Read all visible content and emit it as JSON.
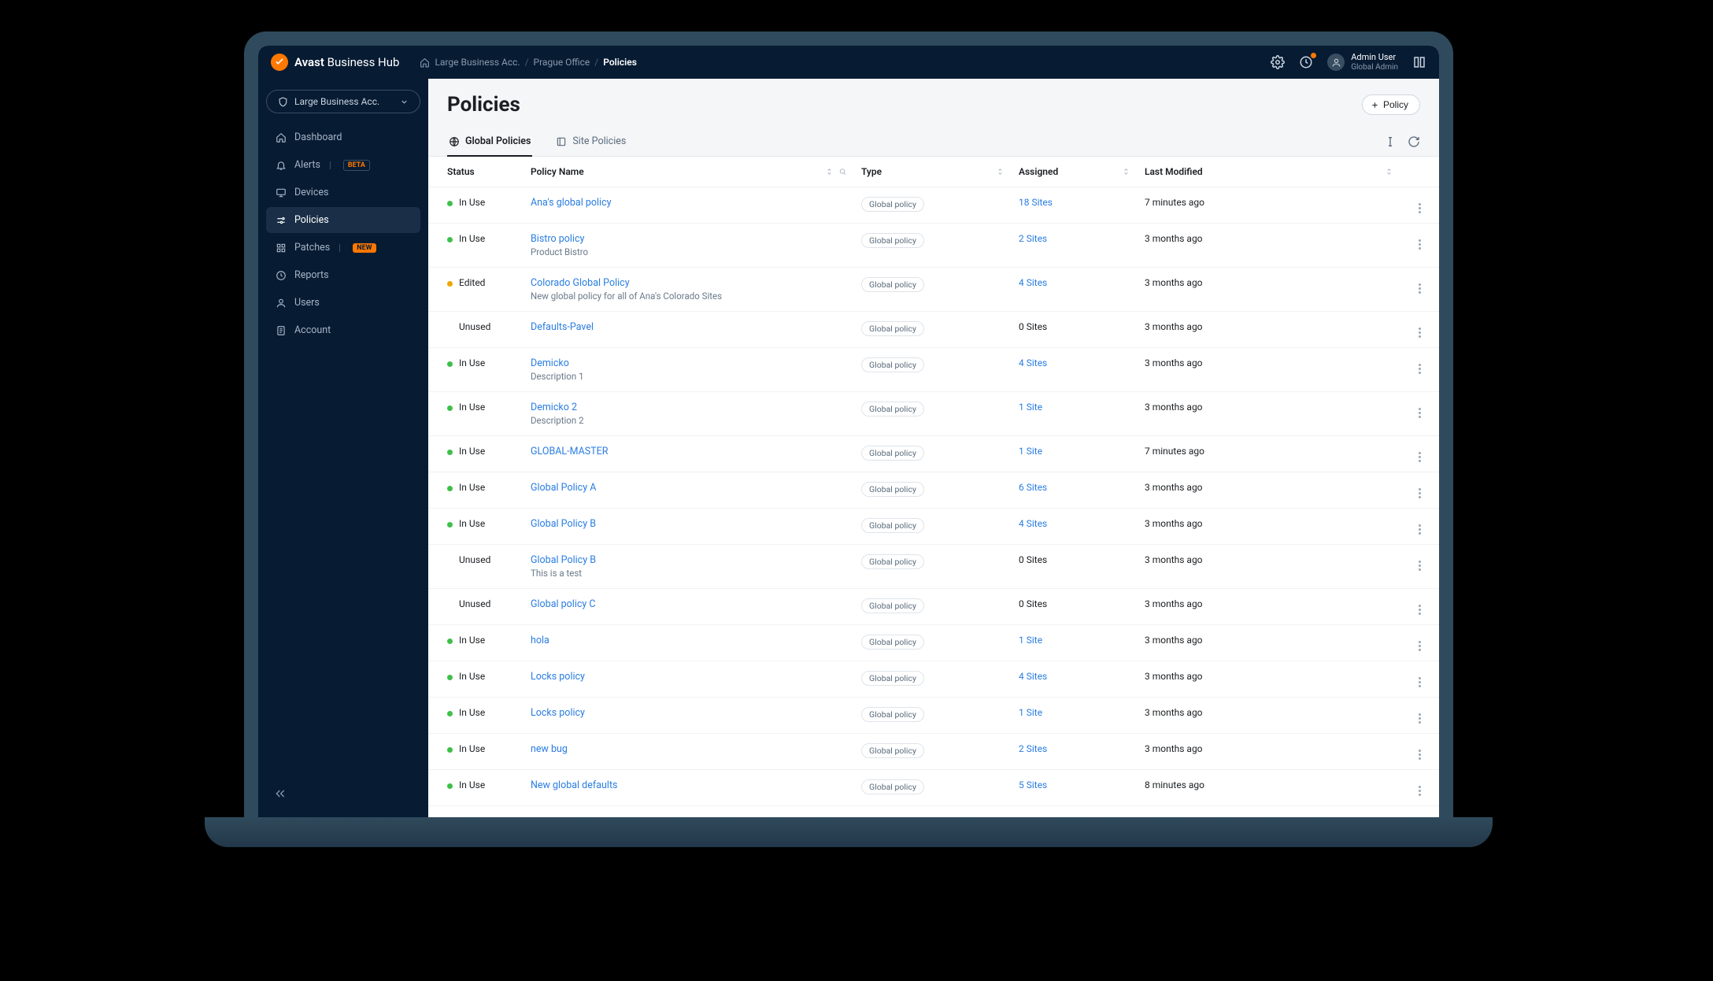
{
  "brand": {
    "prefix": "Avast",
    "suffix": "Business Hub"
  },
  "breadcrumbs": [
    "Large Business Acc.",
    "Prague Office",
    "Policies"
  ],
  "user": {
    "name": "Admin User",
    "role": "Global Admin"
  },
  "siteSelector": "Large Business Acc.",
  "sidebar": {
    "items": [
      {
        "label": "Dashboard",
        "icon": "home"
      },
      {
        "label": "Alerts",
        "icon": "bell",
        "badge": "BETA",
        "badgeStyle": "outline"
      },
      {
        "label": "Devices",
        "icon": "monitor"
      },
      {
        "label": "Policies",
        "icon": "sliders",
        "active": true
      },
      {
        "label": "Patches",
        "icon": "grid",
        "badge": "NEW",
        "badgeStyle": "fill"
      },
      {
        "label": "Reports",
        "icon": "clock"
      },
      {
        "label": "Users",
        "icon": "user"
      },
      {
        "label": "Account",
        "icon": "doc"
      }
    ]
  },
  "page": {
    "title": "Policies",
    "addButton": "Policy",
    "tabs": [
      {
        "label": "Global Policies",
        "active": true
      },
      {
        "label": "Site Policies",
        "active": false
      }
    ],
    "columns": {
      "status": "Status",
      "policyName": "Policy Name",
      "type": "Type",
      "assigned": "Assigned",
      "modified": "Last Modified"
    }
  },
  "typePill": "Global policy",
  "rows": [
    {
      "status": "In Use",
      "dot": "g",
      "name": "Ana's global policy",
      "desc": "",
      "assigned": "18 Sites",
      "assignedLink": true,
      "modified": "7 minutes ago"
    },
    {
      "status": "In Use",
      "dot": "g",
      "name": "Bistro policy",
      "desc": "Product Bistro",
      "assigned": "2 Sites",
      "assignedLink": true,
      "modified": "3 months ago"
    },
    {
      "status": "Edited",
      "dot": "o",
      "name": "Colorado Global Policy",
      "desc": "New global policy for all of Ana's Colorado Sites",
      "assigned": "4 Sites",
      "assignedLink": true,
      "modified": "3 months ago"
    },
    {
      "status": "Unused",
      "dot": "",
      "name": "Defaults-Pavel",
      "desc": "",
      "assigned": "0 Sites",
      "assignedLink": false,
      "modified": "3 months ago"
    },
    {
      "status": "In Use",
      "dot": "g",
      "name": "Demicko",
      "desc": "Description 1",
      "assigned": "4 Sites",
      "assignedLink": true,
      "modified": "3 months ago"
    },
    {
      "status": "In Use",
      "dot": "g",
      "name": "Demicko 2",
      "desc": "Description 2",
      "assigned": "1 Site",
      "assignedLink": true,
      "modified": "3 months ago"
    },
    {
      "status": "In Use",
      "dot": "g",
      "name": "GLOBAL-MASTER",
      "desc": "",
      "assigned": "1 Site",
      "assignedLink": true,
      "modified": "7 minutes ago"
    },
    {
      "status": "In Use",
      "dot": "g",
      "name": "Global Policy A",
      "desc": "",
      "assigned": "6 Sites",
      "assignedLink": true,
      "modified": "3 months ago"
    },
    {
      "status": "In Use",
      "dot": "g",
      "name": "Global Policy B",
      "desc": "",
      "assigned": "4 Sites",
      "assignedLink": true,
      "modified": "3 months ago"
    },
    {
      "status": "Unused",
      "dot": "",
      "name": "Global Policy B",
      "desc": "This is a test",
      "assigned": "0 Sites",
      "assignedLink": false,
      "modified": "3 months ago"
    },
    {
      "status": "Unused",
      "dot": "",
      "name": "Global policy C",
      "desc": "",
      "assigned": "0 Sites",
      "assignedLink": false,
      "modified": "3 months ago"
    },
    {
      "status": "In Use",
      "dot": "g",
      "name": "hola",
      "desc": "",
      "assigned": "1 Site",
      "assignedLink": true,
      "modified": "3 months ago"
    },
    {
      "status": "In Use",
      "dot": "g",
      "name": "Locks policy",
      "desc": "",
      "assigned": "4 Sites",
      "assignedLink": true,
      "modified": "3 months ago"
    },
    {
      "status": "In Use",
      "dot": "g",
      "name": "Locks policy",
      "desc": "",
      "assigned": "1 Site",
      "assignedLink": true,
      "modified": "3 months ago"
    },
    {
      "status": "In Use",
      "dot": "g",
      "name": "new bug",
      "desc": "",
      "assigned": "2 Sites",
      "assignedLink": true,
      "modified": "3 months ago"
    },
    {
      "status": "In Use",
      "dot": "g",
      "name": "New global defaults",
      "desc": "",
      "assigned": "5 Sites",
      "assignedLink": true,
      "modified": "8 minutes ago"
    }
  ]
}
